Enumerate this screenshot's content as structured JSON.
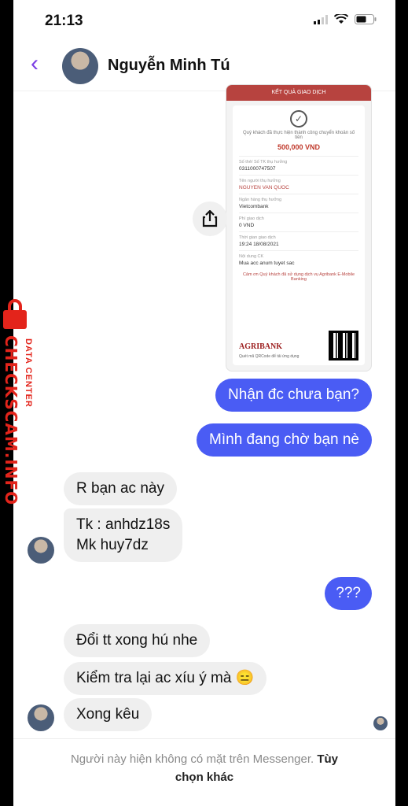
{
  "status_bar": {
    "time": "21:13"
  },
  "header": {
    "contact_name": "Nguyễn Minh Tú"
  },
  "receipt": {
    "title": "KẾT QUẢ GIAO DỊCH",
    "success_text": "Quý khách đã thực hiện thành công chuyển khoản số tiền",
    "amount": "500,000 VND",
    "fields": [
      {
        "label": "Số thẻ/ Số TK thụ hưởng",
        "value": "0311000747507",
        "highlight": false
      },
      {
        "label": "Tên người thụ hưởng",
        "value": "NGUYEN VAN QUOC",
        "highlight": true
      },
      {
        "label": "Ngân hàng thụ hưởng",
        "value": "Vietcombank",
        "highlight": false
      },
      {
        "label": "Phí giao dịch",
        "value": "0 VND",
        "highlight": false
      },
      {
        "label": "Thời gian giao dịch",
        "value": "19:24 18/08/2021",
        "highlight": false
      },
      {
        "label": "Nội dung CK",
        "value": "Mua acc anum tuyet sac",
        "highlight": false
      }
    ],
    "thanks": "Cảm ơn Quý khách đã sử dụng dịch vụ Agribank E-Mobile Banking",
    "bank_logo": "AGRIBANK",
    "qr_note": "Quét mã QRCode để tải ứng dụng"
  },
  "messages": {
    "m1": "Nhận đc chưa bạn?",
    "m2": "Mình đang chờ bạn nè",
    "m3": "R bạn ac này",
    "m4a": "Tk : anhdz18s",
    "m4b": "Mk huy7dz",
    "m5": "???",
    "m6": "Đổi tt xong hú nhe",
    "m7": "Kiểm tra lại ac xíu ý mà 😑",
    "m8": "Xong kêu"
  },
  "footer": {
    "notice": "Người này hiện không có mặt trên Messenger.",
    "options_a": "Tùy",
    "options_b": "chọn khác"
  },
  "watermark": {
    "brand": "CHECKSCAM.INFO",
    "sub": "DATA CENTER"
  },
  "colors": {
    "outgoing": "#4a5cf4",
    "incoming": "#efefef",
    "accent": "#7b3fe4",
    "watermark": "#e3241b"
  }
}
